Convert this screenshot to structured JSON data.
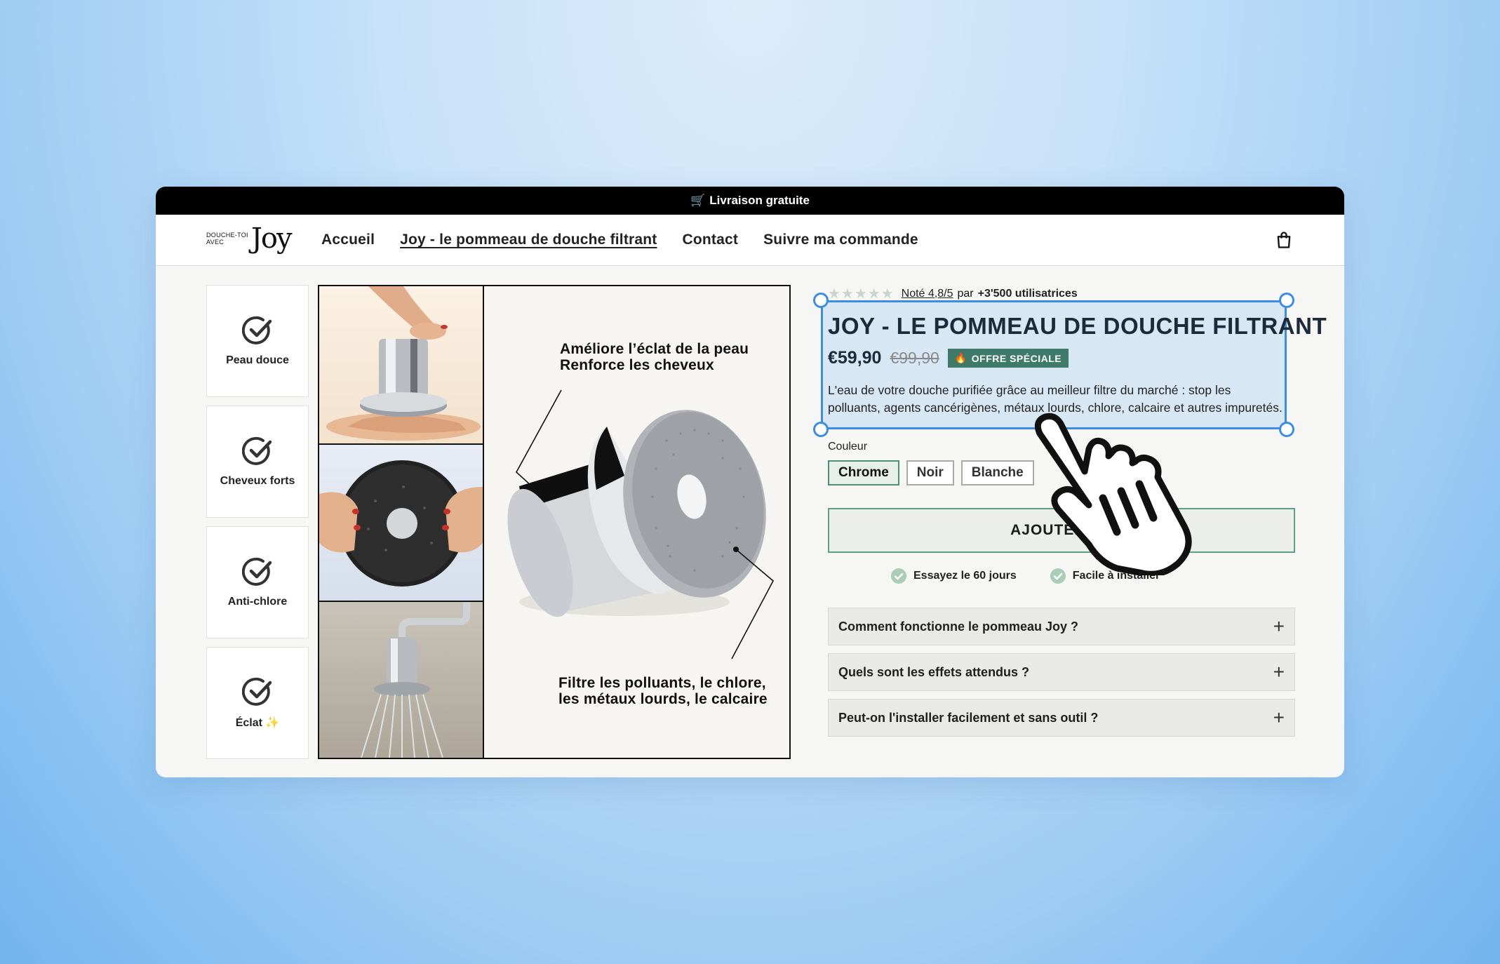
{
  "announcement": {
    "icon": "shopping-cart-icon",
    "text": "Livraison gratuite"
  },
  "logo": {
    "small_line1": "DOUCHE-TOI",
    "small_line2": "AVEC",
    "brand": "Joy"
  },
  "nav": {
    "items": [
      {
        "label": "Accueil"
      },
      {
        "label": "Joy - le pommeau de douche filtrant"
      },
      {
        "label": "Contact"
      },
      {
        "label": "Suivre ma commande"
      }
    ],
    "cart_icon": "shopping-bag-icon"
  },
  "features": [
    {
      "label": "Peau douce",
      "icon": "check-circle-icon"
    },
    {
      "label": "Cheveux forts",
      "icon": "check-circle-icon"
    },
    {
      "label": "Anti-chlore",
      "icon": "check-circle-icon"
    },
    {
      "label": "Éclat",
      "suffix": "✨",
      "icon": "check-circle-icon"
    }
  ],
  "gallery": {
    "caption_top_line1": "Améliore l’éclat de la peau",
    "caption_top_line2": "Renforce les cheveux",
    "caption_bottom_line1": "Filtre les polluants, le chlore,",
    "caption_bottom_line2": "les métaux lourds, le calcaire"
  },
  "product": {
    "rating_text": "Noté 4,8/5",
    "rating_par": "par",
    "rating_users": "+3'500 utilisatrices",
    "title": "JOY - LE POMMEAU DE DOUCHE FILTRANT",
    "price": "€59,90",
    "old_price": "€99,90",
    "badge": "OFFRE SPÉCIALE",
    "description": "L'eau de votre douche purifiée grâce au meilleur filtre du marché : stop les polluants, agents cancérigènes, métaux lourds, chlore, calcaire et autres impuretés.",
    "color_label": "Couleur",
    "variants": [
      "Chrome",
      "Noir",
      "Blanche"
    ],
    "selected_variant": "Chrome",
    "add_button": "AJOUTER AU",
    "perks": [
      "Essayez le 60 jours",
      "Facile à installer"
    ]
  },
  "faq": [
    {
      "question": "Comment fonctionne le pommeau Joy ?"
    },
    {
      "question": "Quels sont les effets attendus ?"
    },
    {
      "question": "Peut-on l'installer facilement et sans outil ?"
    }
  ],
  "colors": {
    "accent": "#3d7a68",
    "selection": "#3b8de6",
    "title": "#1d2a3b"
  }
}
